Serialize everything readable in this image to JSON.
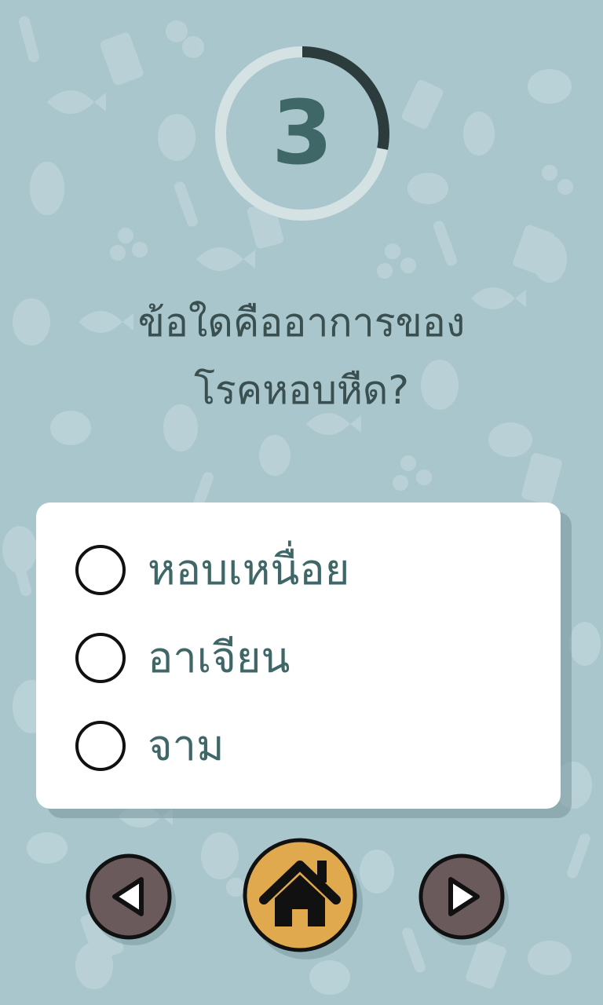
{
  "timer": {
    "number": "3",
    "remaining_fraction": 0.28,
    "ring_color": "#2c3c3d",
    "track_color": "#d4e2e4",
    "number_color": "#3f6768"
  },
  "question": {
    "text": "ข้อใดคืออาการของ\nโรคหอบหืด?"
  },
  "answers": [
    {
      "label": "หอบเหนื่อย",
      "selected": false
    },
    {
      "label": "อาเจียน",
      "selected": false
    },
    {
      "label": "จาม",
      "selected": false
    }
  ],
  "navigation": {
    "prev_icon": "triangle-left-icon",
    "home_icon": "house-icon",
    "next_icon": "triangle-right-icon",
    "arrow_button_color": "#6b5a5c",
    "home_button_color": "#e0a94d"
  },
  "colors": {
    "background": "#a9c6cc",
    "card": "#ffffff",
    "answer_text": "#3f6768",
    "question_text": "#3a4f50"
  }
}
